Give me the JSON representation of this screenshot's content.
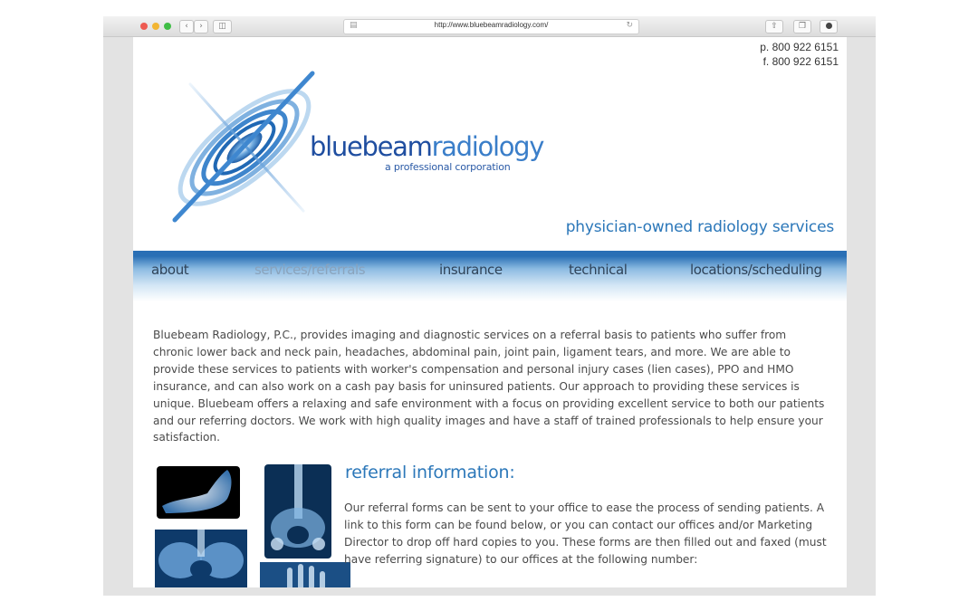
{
  "browser": {
    "url": "http://www.bluebeamradiology.com/"
  },
  "contact": {
    "phone": "p. 800 922 6151",
    "fax": "f. 800 922 6151"
  },
  "brand": {
    "name_part1": "bluebeam",
    "name_part2": "radiology",
    "subtitle": "a professional corporation",
    "tagline": "physician-owned radiology services"
  },
  "nav": {
    "items": [
      {
        "label": "about"
      },
      {
        "label": "services/referrals"
      },
      {
        "label": "insurance"
      },
      {
        "label": "technical"
      },
      {
        "label": "locations/scheduling"
      }
    ]
  },
  "intro": {
    "paragraph": "Bluebeam Radiology, P.C., provides imaging and diagnostic services on a referral basis to patients who suffer from chronic lower back and neck pain, headaches, abdominal pain, joint pain, ligament tears, and more. We are able to provide these services to patients with worker's compensation and personal injury cases (lien cases), PPO and HMO insurance, and can also work on a cash pay basis for uninsured patients. Our approach to providing these services is unique. Bluebeam offers a relaxing and safe environment with a focus on providing excellent service to both our patients and our referring doctors. We work with high quality images and have a staff of trained professionals to help ensure your satisfaction."
  },
  "referral": {
    "title": "referral information:",
    "paragraph": "Our referral forms can be sent to your office to ease the process of sending patients. A link to this form can be found below, or you can contact our offices and/or Marketing Director to drop off hard copies to you. These forms are then filled out and faxed (must have referring signature) to our offices at the following number:"
  },
  "colors": {
    "brand_blue": "#1f4ea0",
    "accent_blue": "#2b77b9",
    "nav_blue": "#2a6fb5"
  },
  "icons": {
    "close": "close-dot",
    "minimize": "minimize-dot",
    "zoom": "zoom-dot",
    "back": "chevron-left-icon",
    "forward": "chevron-right-icon",
    "sidebar": "sidebar-icon",
    "reader": "reader-icon",
    "reload": "reload-icon",
    "share": "share-icon",
    "tabs": "tabs-icon",
    "download": "download-icon"
  }
}
